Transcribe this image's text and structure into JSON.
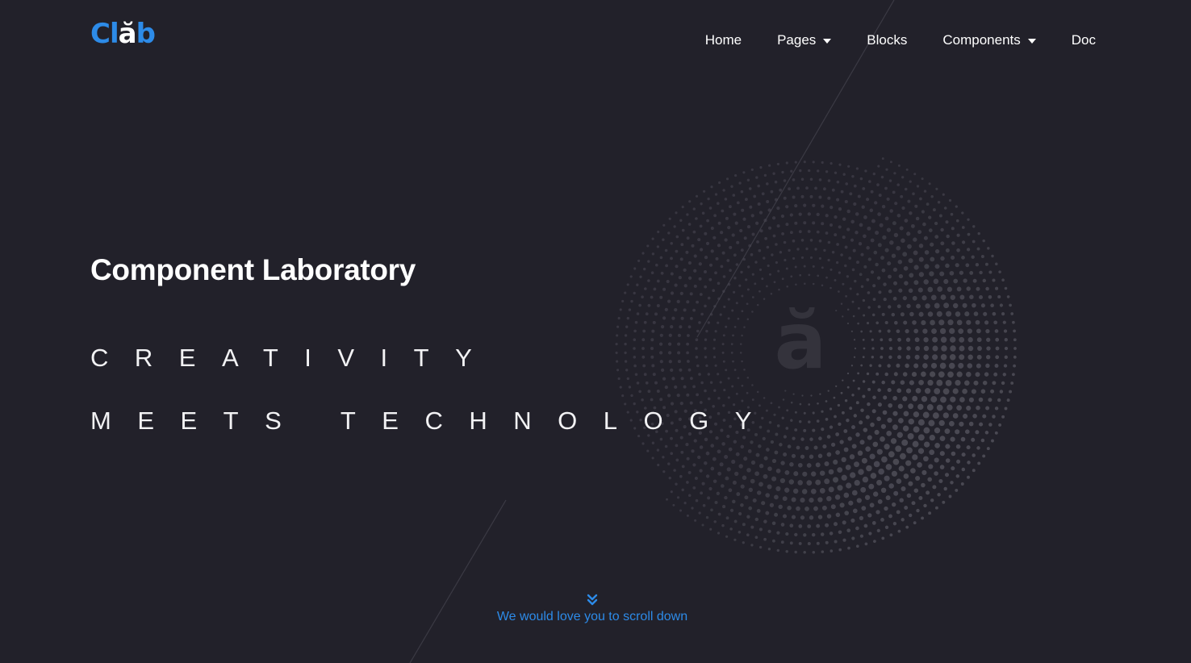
{
  "brand": {
    "logo_start": "Cl",
    "logo_mid": "ă",
    "logo_end": "b",
    "accent_color": "#2d8be8"
  },
  "nav": {
    "items": [
      {
        "label": "Home",
        "dropdown": false
      },
      {
        "label": "Pages",
        "dropdown": true
      },
      {
        "label": "Blocks",
        "dropdown": false
      },
      {
        "label": "Components",
        "dropdown": true
      },
      {
        "label": "Doc",
        "dropdown": false
      }
    ]
  },
  "hero": {
    "title": "Component Laboratory",
    "tagline_line1": "CREATIVITY",
    "tagline_line2": "MEETS TECHNOLOGY",
    "watermark_glyph": "ă"
  },
  "scroll": {
    "icon": "chevron-double-down-icon",
    "text": "We would love you to scroll down"
  },
  "colors": {
    "background": "#22212a",
    "text": "#ffffff",
    "accent": "#2d8be8"
  }
}
